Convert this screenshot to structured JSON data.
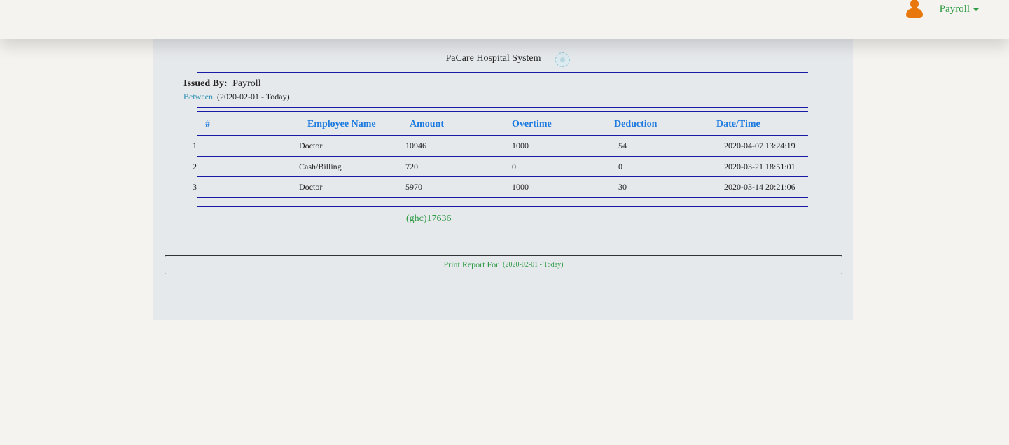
{
  "user_menu": {
    "name": "Payroll"
  },
  "report": {
    "system_title": "PaCare Hospital System",
    "issued_by_label": "Issued By:",
    "issued_by": "Payroll",
    "between_label": "Between",
    "range": "(2020-02-01 - Today)"
  },
  "table": {
    "headers": [
      "#",
      "Employee Name",
      "Amount",
      "Overtime",
      "Deduction",
      "Date/Time"
    ],
    "rows": [
      [
        "1",
        "Doctor",
        "10946",
        "1000",
        "54",
        "2020-04-07 13:24:19"
      ],
      [
        "2",
        "Cash/Billing",
        "720",
        "0",
        "0",
        "2020-03-21 18:51:01"
      ],
      [
        "3",
        "Doctor",
        "5970",
        "1000",
        "30",
        "2020-03-14 20:21:06"
      ]
    ]
  },
  "total": "(ghc)17636",
  "print_button": {
    "label": "Print Report For",
    "range": "(2020-02-01 - Today)"
  },
  "colors": {
    "accent_green": "#2e9a45",
    "header_blue": "#1e7be0",
    "rule_navy": "#1a1aa8",
    "avatar_orange": "#e8770c"
  },
  "icons": {
    "avatar": "user-avatar-icon",
    "menu": "caret-down-icon",
    "seal": "hospital-seal-icon"
  }
}
